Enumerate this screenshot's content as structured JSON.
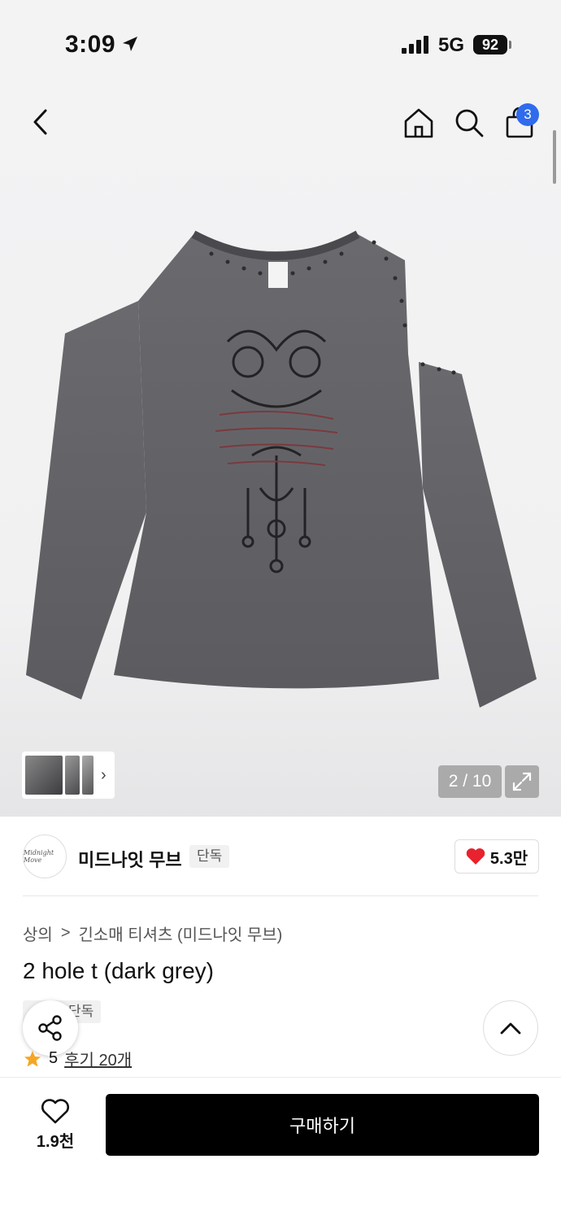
{
  "status_bar": {
    "time": "3:09",
    "network": "5G",
    "battery": "92"
  },
  "header": {
    "cart_count": "3"
  },
  "gallery": {
    "page_indicator": "2 / 10"
  },
  "brand": {
    "name": "미드나잇 무브",
    "tag": "단독",
    "logo_text": "Midnight Move",
    "likes": "5.3만"
  },
  "breadcrumb": {
    "category": "상의",
    "separator": ">",
    "subcategory": "긴소매 티셔츠 (미드나잇 무브)"
  },
  "product": {
    "title": "2 hole t (dark grey)",
    "tag": "단독",
    "rating": "5",
    "reviews": "후기 20개"
  },
  "bottom_bar": {
    "wish_count": "1.9천",
    "buy_label": "구매하기"
  },
  "colors": {
    "accent": "#2f6bec",
    "heart": "#e8222e",
    "star": "#f5a623",
    "buy_button": "#000000"
  }
}
